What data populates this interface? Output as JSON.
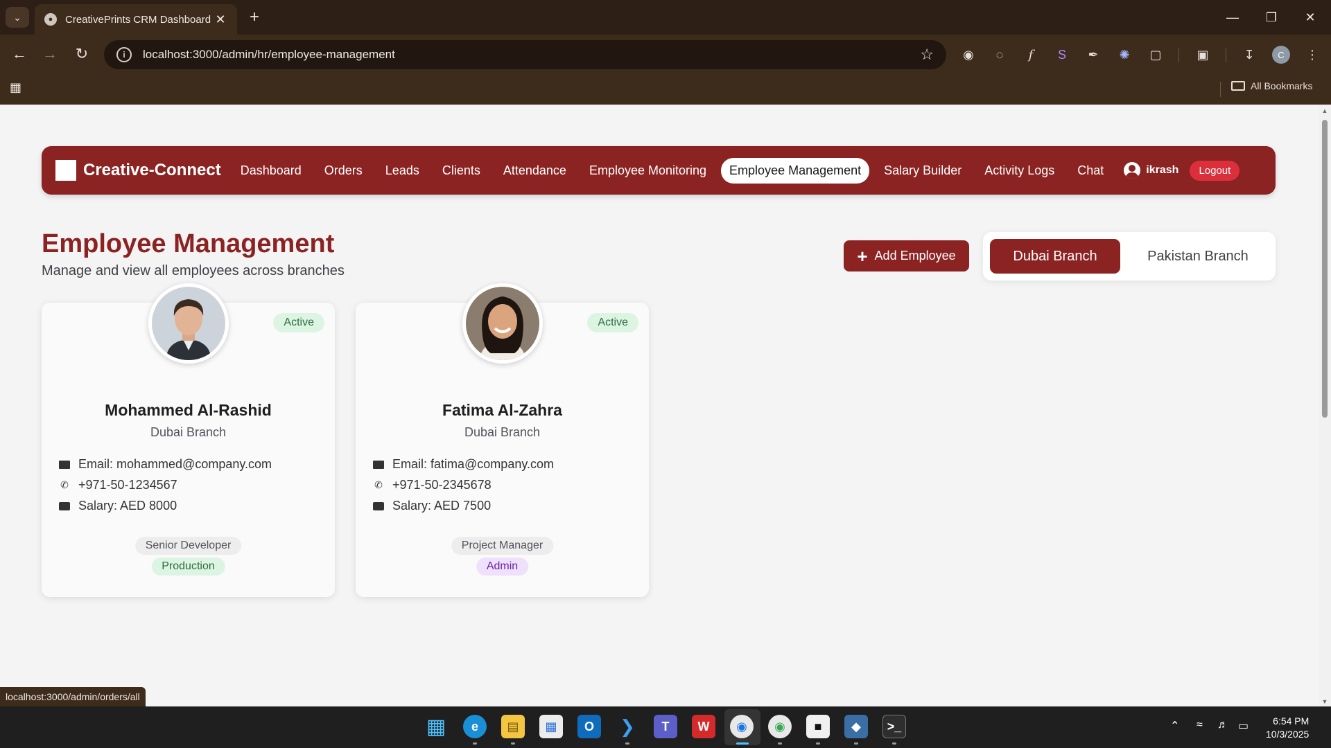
{
  "browser": {
    "tab_title": "CreativePrints CRM Dashboard",
    "url": "localhost:3000/admin/hr/employee-management",
    "bookmarks_label": "All Bookmarks",
    "profile_initial": "C",
    "status_url": "localhost:3000/admin/orders/all"
  },
  "navbar": {
    "brand": "Creative-Connect",
    "links": [
      "Dashboard",
      "Orders",
      "Leads",
      "Clients",
      "Attendance",
      "Employee Monitoring",
      "Employee Management",
      "Salary Builder",
      "Activity Logs",
      "Chat"
    ],
    "active_link": "Employee Management",
    "username": "ikrash",
    "logout_label": "Logout"
  },
  "page": {
    "title": "Employee Management",
    "subtitle": "Manage and view all employees across branches",
    "add_button": "Add Employee",
    "branches": [
      "Dubai Branch",
      "Pakistan Branch"
    ],
    "active_branch": "Dubai Branch"
  },
  "employees": [
    {
      "name": "Mohammed Al-Rashid",
      "branch": "Dubai Branch",
      "status": "Active",
      "email": "Email: mohammed@company.com",
      "phone": "+971-50-1234567",
      "salary": "Salary: AED 8000",
      "role": "Senior Developer",
      "department": "Production"
    },
    {
      "name": "Fatima Al-Zahra",
      "branch": "Dubai Branch",
      "status": "Active",
      "email": "Email: fatima@company.com",
      "phone": "+971-50-2345678",
      "salary": "Salary: AED 7500",
      "role": "Project Manager",
      "department": "Admin"
    }
  ],
  "taskbar": {
    "time": "6:54 PM",
    "date": "10/3/2025"
  },
  "colors": {
    "brand": "#8b2323",
    "logout": "#dc2f3c",
    "status_active_bg": "#dcf5e3",
    "admin_tag_bg": "#efe1fb"
  }
}
